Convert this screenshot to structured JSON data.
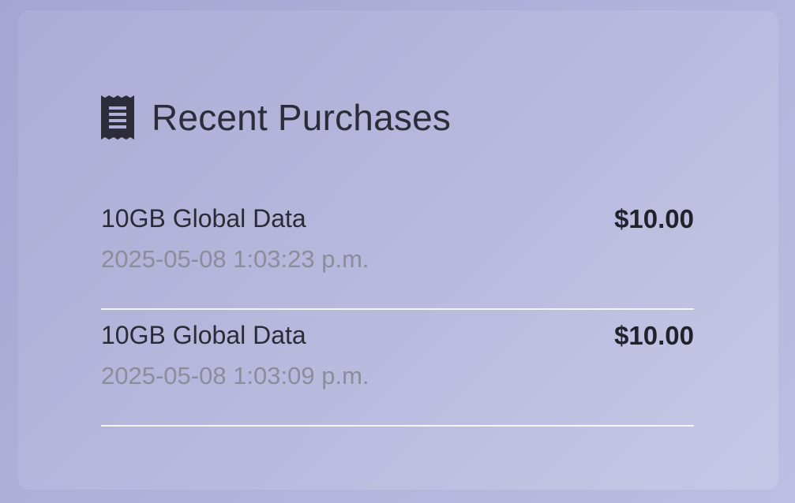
{
  "section": {
    "title": "Recent Purchases",
    "icon": "receipt-icon",
    "icon_color": "#2d2d3a"
  },
  "purchases": [
    {
      "name": "10GB Global Data",
      "datetime": "2025-05-08 1:03:23 p.m.",
      "amount": "$10.00"
    },
    {
      "name": "10GB Global Data",
      "datetime": "2025-05-08 1:03:09 p.m.",
      "amount": "$10.00"
    }
  ]
}
